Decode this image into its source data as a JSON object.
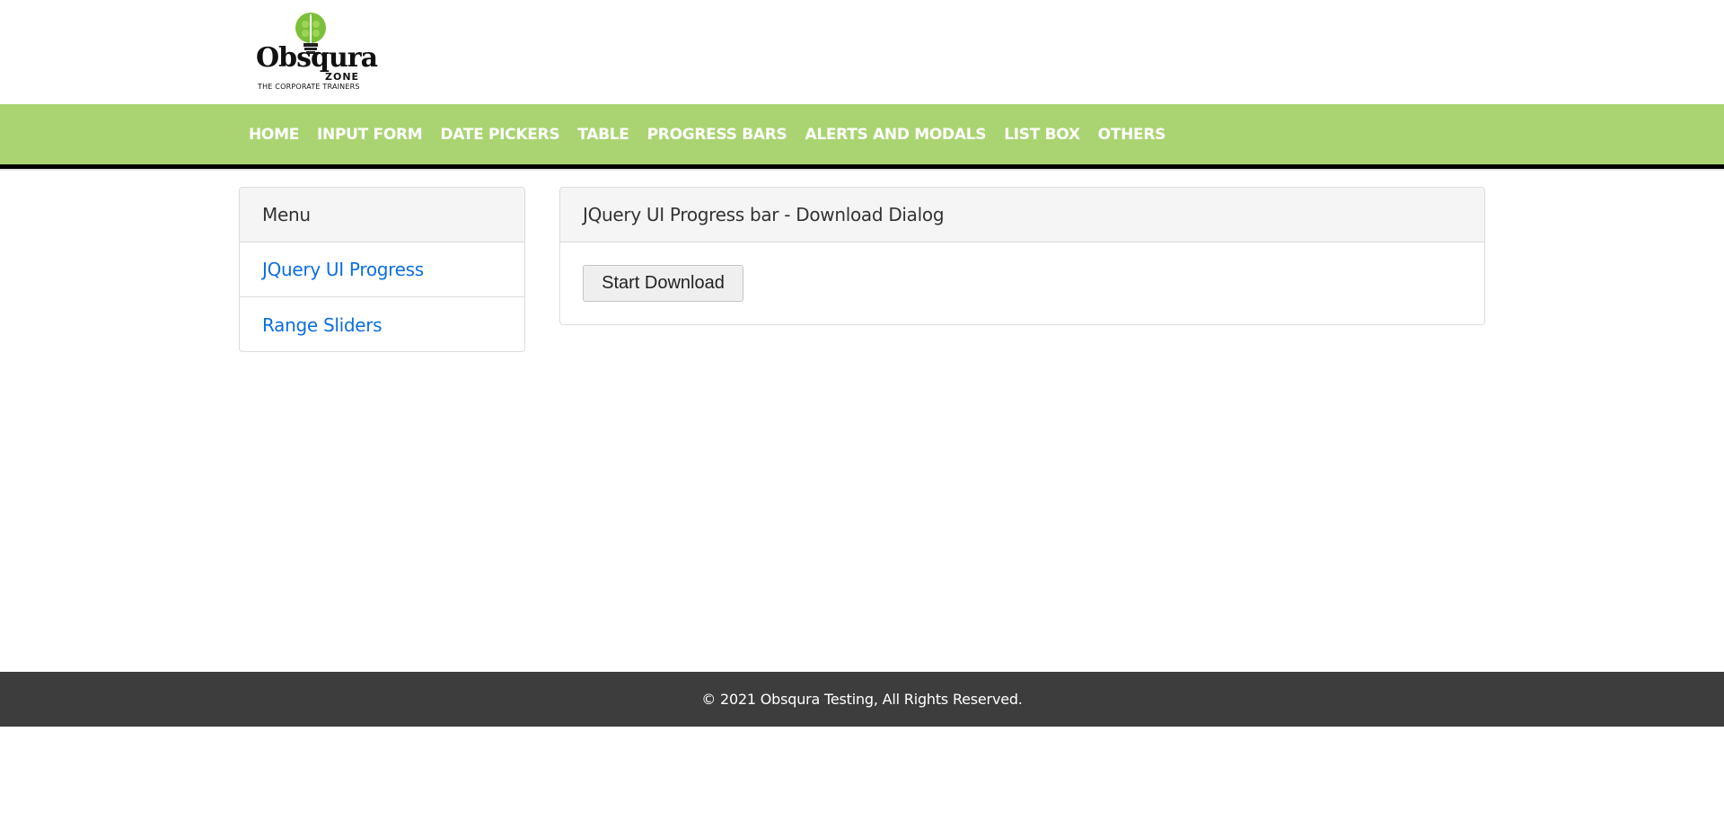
{
  "brand": {
    "name": "Obsqura",
    "sub": "ZONE",
    "tagline": "THE CORPORATE TRAINERS"
  },
  "nav": {
    "items": [
      "HOME",
      "INPUT FORM",
      "DATE PICKERS",
      "TABLE",
      "PROGRESS BARS",
      "ALERTS AND MODALS",
      "LIST BOX",
      "OTHERS"
    ]
  },
  "sidebar": {
    "title": "Menu",
    "items": [
      "JQuery UI Progress",
      "Range Sliders"
    ]
  },
  "main": {
    "title": "JQuery UI Progress bar - Download Dialog",
    "button": "Start Download"
  },
  "footer": {
    "text": "© 2021 Obsqura Testing, All Rights Reserved."
  },
  "colors": {
    "nav_bg": "#aad472",
    "link": "#0d6ede",
    "footer_bg": "#3d3d3d"
  }
}
